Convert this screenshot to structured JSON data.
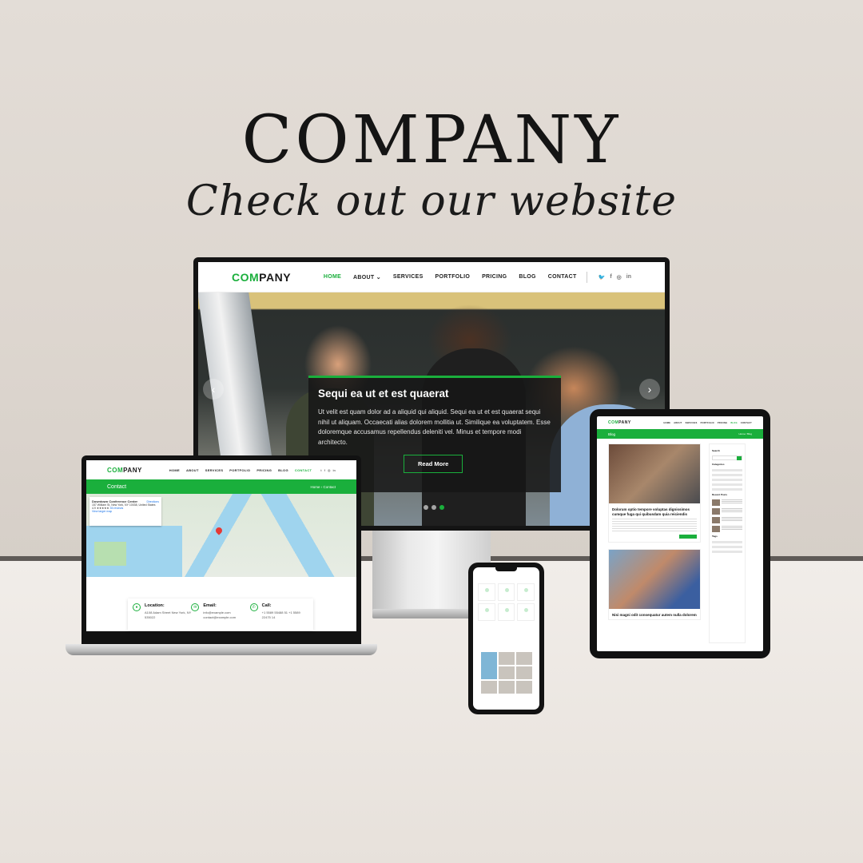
{
  "hero": {
    "title": "COMPANY",
    "subtitle": "Check out our website"
  },
  "brand": {
    "logo_accent": "COM",
    "logo_rest": "PANY",
    "accent_color": "#1aaf3c"
  },
  "desktop": {
    "nav": [
      "HOME",
      "ABOUT",
      "SERVICES",
      "PORTFOLIO",
      "PRICING",
      "BLOG",
      "CONTACT"
    ],
    "active_nav": "HOME",
    "social_icons": [
      "twitter-icon",
      "facebook-icon",
      "instagram-icon",
      "linkedin-icon"
    ],
    "slide": {
      "title": "Sequi ea ut et est quaerat",
      "text": "Ut velit est quam dolor ad a aliquid qui aliquid. Sequi ea ut et est quaerat sequi nihil ut aliquam. Occaecati alias dolorem mollitia ut. Similique ea voluptatem. Esse doloremque accusamus repellendus deleniti vel. Minus et tempore modi architecto.",
      "button": "Read More"
    }
  },
  "laptop": {
    "nav": [
      "HOME",
      "ABOUT",
      "SERVICES",
      "PORTFOLIO",
      "PRICING",
      "BLOG",
      "CONTACT"
    ],
    "active_nav": "CONTACT",
    "page_title": "Contact",
    "breadcrumb": "Home  ›  Contact",
    "map_card": {
      "name": "Downtown Conference Center",
      "address": "157 William St, New York, NY 10038, United States",
      "rating": "4.9 ★★★★★",
      "reviews": "35 reviews",
      "directions": "Directions",
      "larger_map": "View larger map"
    },
    "contact": {
      "location_label": "Location:",
      "location_value": "A108 Adam Street New York, NY 535022",
      "email_label": "Email:",
      "email_value": "info@example.com contact@example.com",
      "call_label": "Call:",
      "call_value": "+1 5589 55488 51 +1 5589 22475 14"
    }
  },
  "tablet": {
    "page_title": "Blog",
    "breadcrumb": "Home / Blog",
    "posts": [
      "Dolorum optio tempore voluptas dignissimos cumque fuga qui quibusdam quia reiciendis",
      "Nisi magni odit consequatur autem nulla dolorem"
    ],
    "sidebar": [
      "Search",
      "Categories",
      "Recent Posts",
      "Tags"
    ]
  }
}
